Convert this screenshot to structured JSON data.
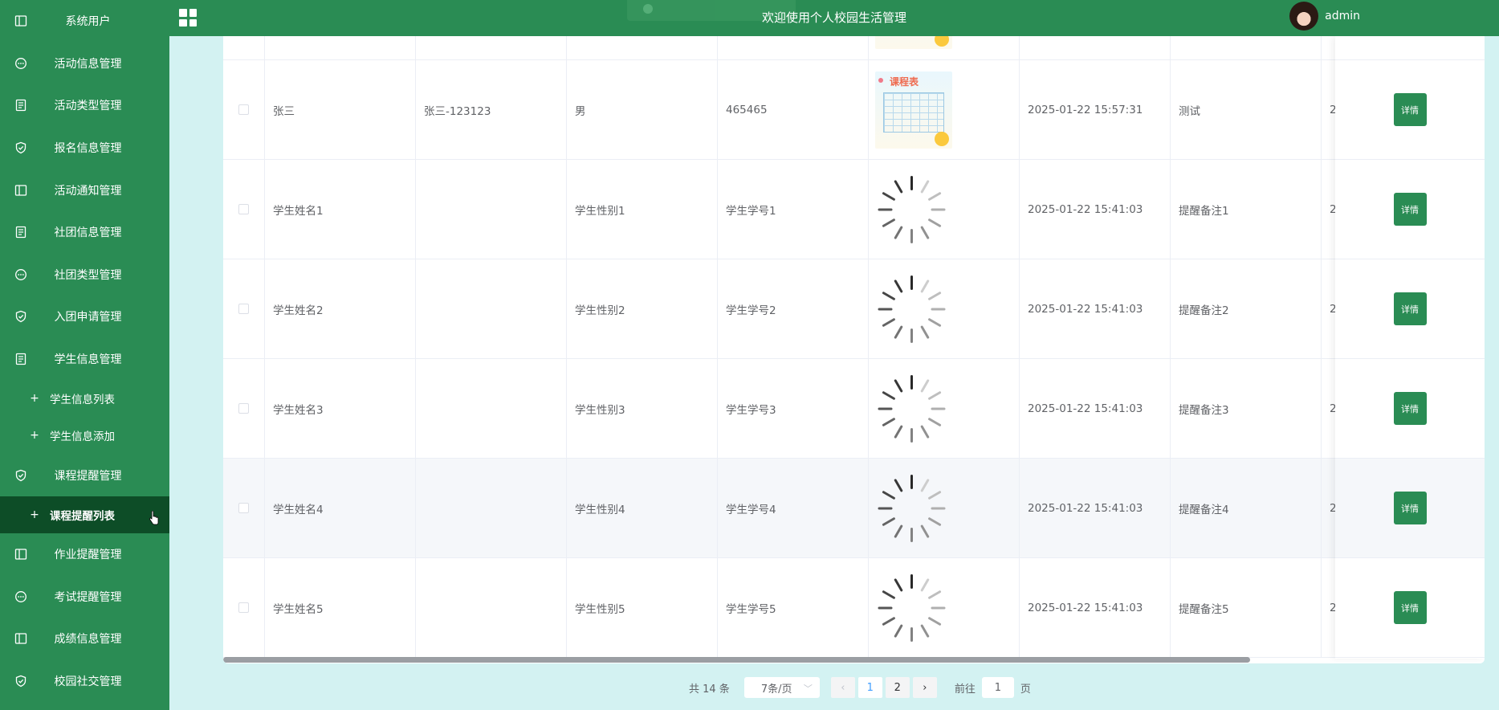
{
  "sidebar": {
    "items": [
      {
        "label": "系统用户",
        "icon": "columns-icon"
      },
      {
        "label": "活动信息管理",
        "icon": "chat-icon"
      },
      {
        "label": "活动类型管理",
        "icon": "document-icon"
      },
      {
        "label": "报名信息管理",
        "icon": "shield-check-icon"
      },
      {
        "label": "活动通知管理",
        "icon": "columns-icon"
      },
      {
        "label": "社团信息管理",
        "icon": "document-icon"
      },
      {
        "label": "社团类型管理",
        "icon": "chat-icon"
      },
      {
        "label": "入团申请管理",
        "icon": "shield-check-icon"
      },
      {
        "label": "学生信息管理",
        "icon": "document-icon"
      }
    ],
    "student_sub": [
      "学生信息列表",
      "学生信息添加"
    ],
    "course_menu": {
      "label": "课程提醒管理",
      "icon": "shield-check-icon"
    },
    "course_sub": [
      "课程提醒列表"
    ],
    "items_after": [
      {
        "label": "作业提醒管理",
        "icon": "columns-icon"
      },
      {
        "label": "考试提醒管理",
        "icon": "chat-icon"
      },
      {
        "label": "成绩信息管理",
        "icon": "columns-icon"
      },
      {
        "label": "校园社交管理",
        "icon": "shield-check-icon"
      }
    ]
  },
  "header": {
    "title": "欢迎使用个人校园生活管理",
    "username": "admin"
  },
  "table": {
    "rows": [
      {
        "name": "张三",
        "account": "张三-123123",
        "sex": "男",
        "number": "465465",
        "image": "schedule",
        "time": "2025-01-22 15:57:31",
        "note": "测试",
        "extra": "2"
      },
      {
        "name": "学生姓名1",
        "account": "",
        "sex": "学生性别1",
        "number": "学生学号1",
        "image": "spinner",
        "time": "2025-01-22 15:41:03",
        "note": "提醒备注1",
        "extra": "2"
      },
      {
        "name": "学生姓名2",
        "account": "",
        "sex": "学生性别2",
        "number": "学生学号2",
        "image": "spinner",
        "time": "2025-01-22 15:41:03",
        "note": "提醒备注2",
        "extra": "2"
      },
      {
        "name": "学生姓名3",
        "account": "",
        "sex": "学生性别3",
        "number": "学生学号3",
        "image": "spinner",
        "time": "2025-01-22 15:41:03",
        "note": "提醒备注3",
        "extra": "2"
      },
      {
        "name": "学生姓名4",
        "account": "",
        "sex": "学生性别4",
        "number": "学生学号4",
        "image": "spinner",
        "time": "2025-01-22 15:41:03",
        "note": "提醒备注4",
        "extra": "2"
      },
      {
        "name": "学生姓名5",
        "account": "",
        "sex": "学生性别5",
        "number": "学生学号5",
        "image": "spinner",
        "time": "2025-01-22 15:41:03",
        "note": "提醒备注5",
        "extra": "2"
      }
    ],
    "detail_label": "详情",
    "schedule_title": "课程表"
  },
  "pagination": {
    "total": "共 14 条",
    "page_size": "7条/页",
    "pages": [
      "1",
      "2"
    ],
    "current": "1",
    "jump_prefix": "前往",
    "jump_value": "1",
    "jump_suffix": "页"
  },
  "colors": {
    "primary": "#2a8c54",
    "active_sub": "#0d4d27",
    "background": "#d3f2f2"
  }
}
